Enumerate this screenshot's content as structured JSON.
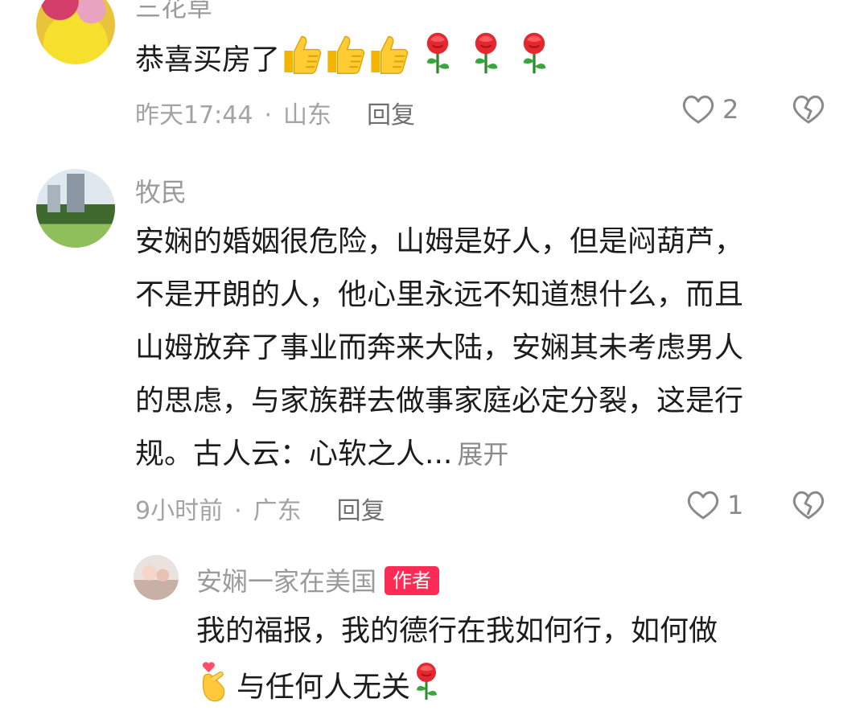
{
  "comments": [
    {
      "username": "三花草",
      "text": "恭喜买房了",
      "time": "昨天17:44",
      "location": "山东",
      "reply_label": "回复",
      "likes": "2"
    },
    {
      "username": "牧民",
      "text_lines": [
        "安娴的婚姻很危险，山姆是好人，但是闷葫芦，",
        "不是开朗的人，他心里永远不知道想什么，而且",
        "山姆放弃了事业而奔来大陆，安娴其未考虑男人",
        "的思虑，与家族群去做事家庭必定分裂，这是行",
        "规。古人云：心软之人..."
      ],
      "expand_label": "展开",
      "time": "9小时前",
      "location": "广东",
      "reply_label": "回复",
      "likes": "1"
    }
  ],
  "reply": {
    "username": "安娴一家在美国",
    "badge": "作者",
    "text_line1": "我的福报，我的德行在我如何行，如何做",
    "text_line2": "与任何人无关"
  },
  "icons": {
    "like": "heart-outline-icon",
    "dislike": "broken-heart-icon",
    "thumbs": "thumbs-up-emoji",
    "rose": "rose-emoji",
    "finger_heart": "finger-heart-emoji"
  },
  "colors": {
    "author_badge": "#fe2c55",
    "meta_text": "#a3a3a3",
    "username": "#9a9a9a"
  }
}
